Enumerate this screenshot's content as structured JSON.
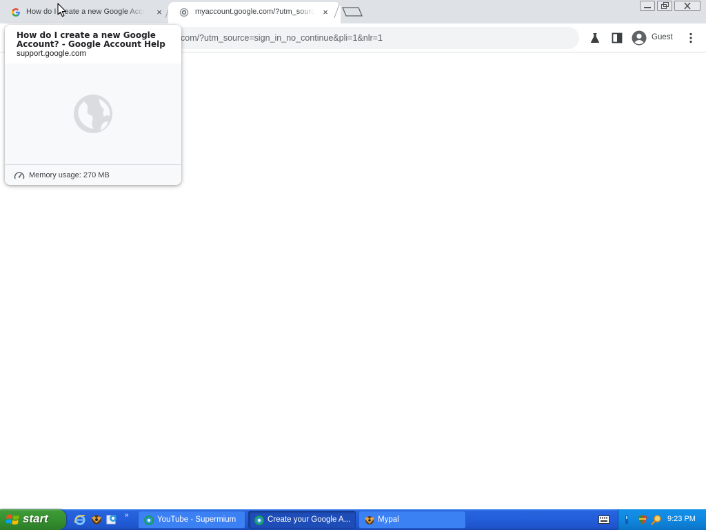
{
  "browser": {
    "tabs": [
      {
        "title": "How do I create a new Google Account? - Google Account Help",
        "favicon": "google-g-icon",
        "close": "×"
      },
      {
        "title": "myaccount.google.com/?utm_source=sign_in_no_continue&pli=1&nlr=1",
        "favicon": "loading-spinner-icon",
        "close": "×"
      }
    ],
    "omnibox": {
      "visible_text": "com/?utm_source=sign_in_no_continue&pli=1&nlr=1"
    },
    "profile": {
      "label": "Guest"
    },
    "hover_card": {
      "title": "How do I create a new Google Account? - Google Account Help",
      "domain": "support.google.com",
      "memory": "Memory usage: 270 MB"
    }
  },
  "taskbar": {
    "start_label": "start",
    "tasks": [
      {
        "label": "YouTube - Supermium",
        "icon": "supermium-icon"
      },
      {
        "label": "Create your Google A...",
        "icon": "supermium-icon"
      },
      {
        "label": "Mypal",
        "icon": "mypal-icon"
      }
    ],
    "clock": "9:23 PM"
  },
  "colors": {
    "tab_strip": "#dee1e6",
    "active_tab": "#ffffff",
    "omnibox_bg": "#f1f3f4",
    "taskbar_blue": "#245edb",
    "start_green": "#35912f",
    "tray_blue": "#0f87e0"
  }
}
